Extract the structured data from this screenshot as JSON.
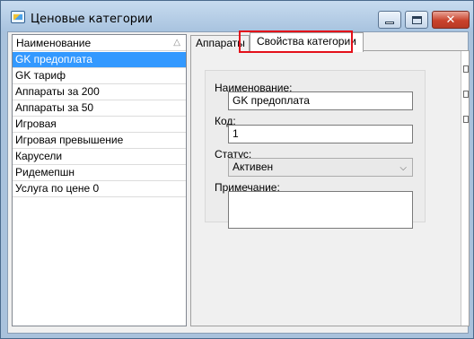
{
  "window": {
    "title": "Ценовые категории"
  },
  "list": {
    "header": "Наименование",
    "items": [
      {
        "label": "GK  предоплата",
        "selected": true
      },
      {
        "label": "GK тариф",
        "selected": false
      },
      {
        "label": "Аппараты за 200",
        "selected": false
      },
      {
        "label": "Аппараты за 50",
        "selected": false
      },
      {
        "label": "Игровая",
        "selected": false
      },
      {
        "label": "Игровая превышение",
        "selected": false
      },
      {
        "label": "Карусели",
        "selected": false
      },
      {
        "label": "Ридемепшн",
        "selected": false
      },
      {
        "label": "Услуга по цене 0",
        "selected": false
      }
    ]
  },
  "tabs": {
    "devices": "Аппараты",
    "properties": "Свойства категории"
  },
  "form": {
    "name_label": "Наименование:",
    "name_value": "GK  предоплата",
    "code_label": "Код:",
    "code_value": "1",
    "status_label": "Статус:",
    "status_value": "Активен",
    "note_label": "Примечание:",
    "note_value": ""
  },
  "colors": {
    "selection": "#3399ff",
    "highlight": "#e3101a",
    "close_button": "#c9432c"
  }
}
